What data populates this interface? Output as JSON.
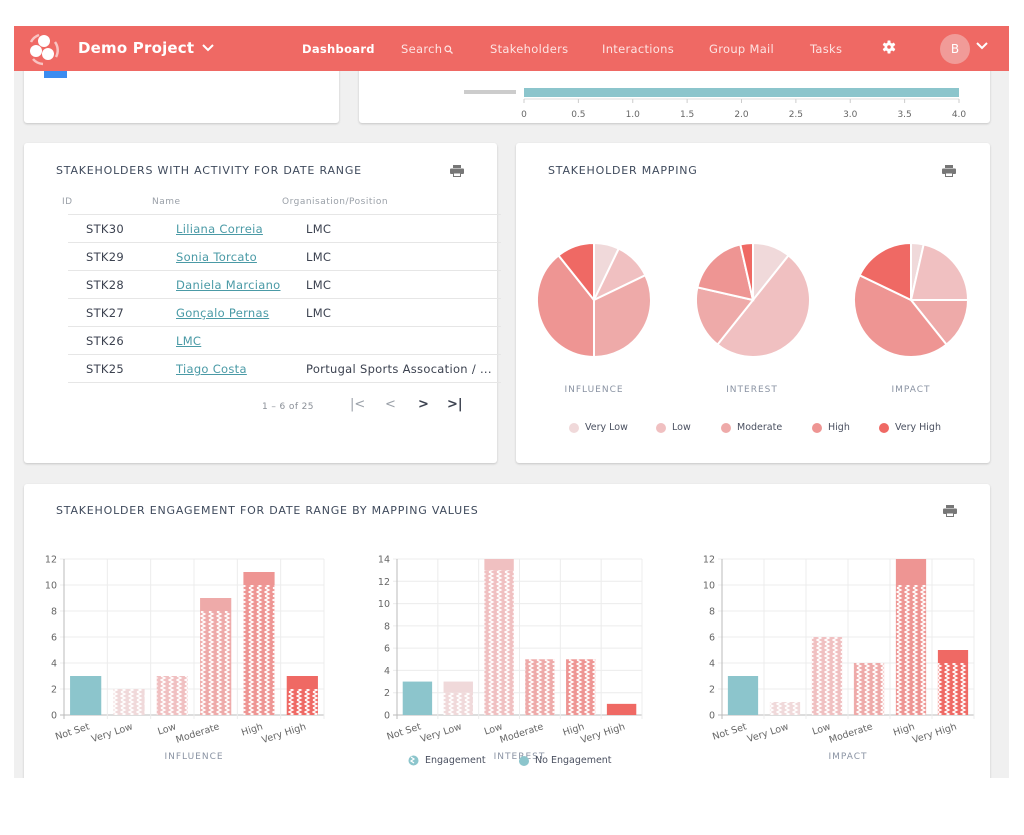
{
  "header": {
    "project_name": "Demo Project",
    "nav": [
      {
        "label": "Dashboard",
        "active": true
      },
      {
        "label": "Search",
        "icon": "search-icon"
      },
      {
        "label": "Stakeholders"
      },
      {
        "label": "Interactions"
      },
      {
        "label": "Group Mail"
      },
      {
        "label": "Tasks"
      }
    ],
    "avatar_initial": "B",
    "brand_color": "#ef6964"
  },
  "top_chart": {
    "x_ticks": [
      "0",
      "0.5",
      "1.0",
      "1.5",
      "2.0",
      "2.5",
      "3.0",
      "3.5",
      "4.0"
    ],
    "bar_value": 4.0,
    "bar_color": "#8cc5cc"
  },
  "stakeholders_table": {
    "title": "STAKEHOLDERS WITH ACTIVITY FOR DATE RANGE",
    "columns": [
      "ID",
      "Name",
      "Organisation/Position"
    ],
    "rows": [
      {
        "id": "STK30",
        "name": "Liliana Correia",
        "org": "LMC"
      },
      {
        "id": "STK29",
        "name": "Sonia Torcato",
        "org": "LMC"
      },
      {
        "id": "STK28",
        "name": "Daniela Marciano",
        "org": "LMC"
      },
      {
        "id": "STK27",
        "name": "Gonçalo Pernas",
        "org": "LMC"
      },
      {
        "id": "STK26",
        "name": "LMC",
        "org": ""
      },
      {
        "id": "STK25",
        "name": "Tiago Costa",
        "org": "Portugal Sports Assocation / ..."
      }
    ],
    "pagination": {
      "range_text": "1 – 6 of 25",
      "first": "|<",
      "prev": "<",
      "next": ">",
      "last": ">|"
    }
  },
  "mapping": {
    "title": "STAKEHOLDER MAPPING",
    "legend": [
      {
        "label": "Very Low",
        "color": "#f0d9da"
      },
      {
        "label": "Low",
        "color": "#f0c0c1"
      },
      {
        "label": "Moderate",
        "color": "#eeaaa9"
      },
      {
        "label": "High",
        "color": "#ee9593"
      },
      {
        "label": "Very High",
        "color": "#ef6964"
      }
    ]
  },
  "engagement": {
    "title": "STAKEHOLDER ENGAGEMENT FOR DATE RANGE BY MAPPING VALUES",
    "legend": [
      {
        "label": "Engagement",
        "icon": "hatched-circle"
      },
      {
        "label": "No Engagement",
        "icon": "solid-circle",
        "color": "#8cc5cc"
      }
    ],
    "not_set_color": "#8cc5cc"
  },
  "chart_data": [
    {
      "type": "pie",
      "title": "INFLUENCE",
      "categories": [
        "Very Low",
        "Low",
        "Moderate",
        "High",
        "Very High"
      ],
      "values": [
        2,
        3,
        9,
        11,
        3
      ]
    },
    {
      "type": "pie",
      "title": "INTEREST",
      "categories": [
        "Very Low",
        "Low",
        "Moderate",
        "High",
        "Very High"
      ],
      "values": [
        3,
        14,
        5,
        5,
        1
      ]
    },
    {
      "type": "pie",
      "title": "IMPACT",
      "categories": [
        "Very Low",
        "Low",
        "Moderate",
        "High",
        "Very High"
      ],
      "values": [
        1,
        6,
        4,
        12,
        5
      ]
    },
    {
      "type": "bar",
      "stacked": true,
      "xlabel": "INFLUENCE",
      "categories": [
        "Not Set",
        "Very Low",
        "Low",
        "Moderate",
        "High",
        "Very High"
      ],
      "series": [
        {
          "name": "Engagement",
          "values": [
            0,
            2,
            3,
            8,
            10,
            2
          ]
        },
        {
          "name": "No Engagement",
          "values": [
            3,
            0,
            0,
            1,
            1,
            1
          ]
        }
      ],
      "ylim": [
        0,
        12
      ],
      "yticks": [
        0,
        2,
        4,
        6,
        8,
        10,
        12
      ],
      "grid": true
    },
    {
      "type": "bar",
      "stacked": true,
      "xlabel": "INTEREST",
      "categories": [
        "Not Set",
        "Very Low",
        "Low",
        "Moderate",
        "High",
        "Very High"
      ],
      "series": [
        {
          "name": "Engagement",
          "values": [
            0,
            2,
            13,
            5,
            5,
            0
          ]
        },
        {
          "name": "No Engagement",
          "values": [
            3,
            1,
            1,
            0,
            0,
            1
          ]
        }
      ],
      "ylim": [
        0,
        14
      ],
      "yticks": [
        0,
        2,
        4,
        6,
        8,
        10,
        12,
        14
      ],
      "grid": true
    },
    {
      "type": "bar",
      "stacked": true,
      "xlabel": "IMPACT",
      "categories": [
        "Not Set",
        "Very Low",
        "Low",
        "Moderate",
        "High",
        "Very High"
      ],
      "series": [
        {
          "name": "Engagement",
          "values": [
            0,
            1,
            6,
            4,
            10,
            4
          ]
        },
        {
          "name": "No Engagement",
          "values": [
            3,
            0,
            0,
            0,
            2,
            1
          ]
        }
      ],
      "ylim": [
        0,
        12
      ],
      "yticks": [
        0,
        2,
        4,
        6,
        8,
        10,
        12
      ],
      "grid": true
    }
  ]
}
